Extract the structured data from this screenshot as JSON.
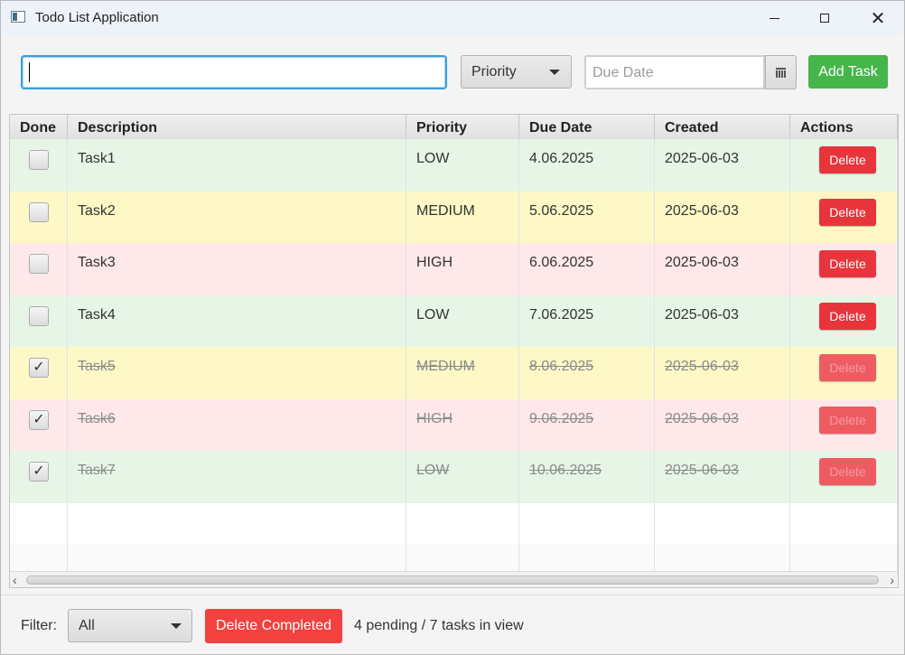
{
  "window": {
    "title": "Todo List Application",
    "icon": "app-window-icon"
  },
  "toolbar": {
    "description_value": "",
    "priority_label": "Priority",
    "due_date_placeholder": "Due Date",
    "add_label": "Add Task"
  },
  "table": {
    "columns": [
      "Done",
      "Description",
      "Priority",
      "Due Date",
      "Created",
      "Actions"
    ],
    "rows": [
      {
        "done": false,
        "checkbox": "",
        "description": "Task1",
        "priority": "LOW",
        "due": "4.06.2025",
        "created": "2025-06-03",
        "action": "Delete"
      },
      {
        "done": false,
        "checkbox": "",
        "description": "Task2",
        "priority": "MEDIUM",
        "due": "5.06.2025",
        "created": "2025-06-03",
        "action": "Delete"
      },
      {
        "done": false,
        "checkbox": "",
        "description": "Task3",
        "priority": "HIGH",
        "due": "6.06.2025",
        "created": "2025-06-03",
        "action": "Delete"
      },
      {
        "done": false,
        "checkbox": "",
        "description": "Task4",
        "priority": "LOW",
        "due": "7.06.2025",
        "created": "2025-06-03",
        "action": "Delete"
      },
      {
        "done": true,
        "checkbox": "✓",
        "description": "Task5",
        "priority": "MEDIUM",
        "due": "8.06.2025",
        "created": "2025-06-03",
        "action": "Delete"
      },
      {
        "done": true,
        "checkbox": "✓",
        "description": "Task6",
        "priority": "HIGH",
        "due": "9.06.2025",
        "created": "2025-06-03",
        "action": "Delete"
      },
      {
        "done": true,
        "checkbox": "✓",
        "description": "Task7",
        "priority": "LOW",
        "due": "10.06.2025",
        "created": "2025-06-03",
        "action": "Delete"
      }
    ],
    "row_colors": {
      "LOW": "#e7f5e7",
      "MEDIUM": "#fdf8c6",
      "HIGH": "#ffe8ea"
    }
  },
  "footer": {
    "filter_label": "Filter:",
    "filter_value": "All",
    "delete_completed_label": "Delete Completed",
    "status": "4 pending / 7 tasks in view"
  },
  "colors": {
    "accent_green": "#46b54a",
    "delete_red": "#e8343b",
    "focus_blue": "#3a9fde"
  }
}
